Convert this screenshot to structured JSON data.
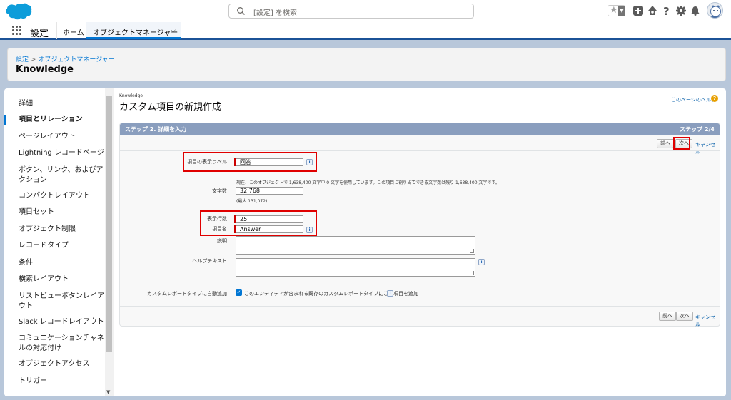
{
  "header": {
    "search_placeholder": "[設定] を検索",
    "icons": [
      "favorites-star-icon",
      "favorites-dropdown-icon",
      "global-actions-plus-icon",
      "trailhead-icon",
      "help-icon",
      "setup-gear-icon",
      "notifications-bell-icon",
      "user-avatar"
    ]
  },
  "nav": {
    "app_name": "設定",
    "home": "ホーム",
    "tab": "オブジェクトマネージャー"
  },
  "page_header": {
    "breadcrumb_root": "設定",
    "breadcrumb_sep": ">",
    "breadcrumb_current": "オブジェクトマネージャー",
    "title": "Knowledge"
  },
  "sidebar": {
    "items": [
      {
        "label": "詳細",
        "active": false
      },
      {
        "label": "項目とリレーション",
        "active": true
      },
      {
        "label": "ページレイアウト",
        "active": false
      },
      {
        "label": "Lightning レコードページ",
        "active": false
      },
      {
        "label": "ボタン、リンク、およびアクション",
        "active": false
      },
      {
        "label": "コンパクトレイアウト",
        "active": false
      },
      {
        "label": "項目セット",
        "active": false
      },
      {
        "label": "オブジェクト制限",
        "active": false
      },
      {
        "label": "レコードタイプ",
        "active": false
      },
      {
        "label": "条件",
        "active": false
      },
      {
        "label": "検索レイアウト",
        "active": false
      },
      {
        "label": "リストビューボタンレイアウト",
        "active": false
      },
      {
        "label": "Slack レコードレイアウト",
        "active": false
      },
      {
        "label": "コミュニケーションチャネルの対応付け",
        "active": false
      },
      {
        "label": "オブジェクトアクセス",
        "active": false
      },
      {
        "label": "トリガー",
        "active": false
      }
    ]
  },
  "main": {
    "object_label": "Knowledge",
    "title": "カスタム項目の新規作成",
    "help_link": "このページのヘルプ",
    "step_title": "ステップ 2. 詳細を入力",
    "step_count": "ステップ 2/4",
    "buttons": {
      "prev": "前へ",
      "next": "次へ",
      "cancel": "キャンセル"
    },
    "fields": {
      "display_label": {
        "label": "項目の表示ラベル",
        "value": "回答"
      },
      "length_note": "現在、このオブジェクトで 1,638,400 文字中 0 文字を使用しています。この項目に割り当てできる文字数は残り 1,638,400 文字です。",
      "char_count": {
        "label": "文字数",
        "value": "32,768",
        "note": "(最大 131,072)"
      },
      "visible_lines": {
        "label": "表示行数",
        "value": "25"
      },
      "field_name": {
        "label": "項目名",
        "value": "Answer"
      },
      "description": {
        "label": "説明",
        "value": ""
      },
      "help_text": {
        "label": "ヘルプテキスト",
        "value": ""
      },
      "add_to_report": {
        "label": "カスタムレポートタイプに自動追加",
        "checkbox_text": "このエンティティが含まれる既存のカスタムレポートタイプにこの項目を追加",
        "checked": true
      }
    }
  },
  "colors": {
    "brand_blue": "#0176d3",
    "highlight_red": "#e00000",
    "step_header": "#8a9ebe",
    "band": "#b8c7da"
  }
}
